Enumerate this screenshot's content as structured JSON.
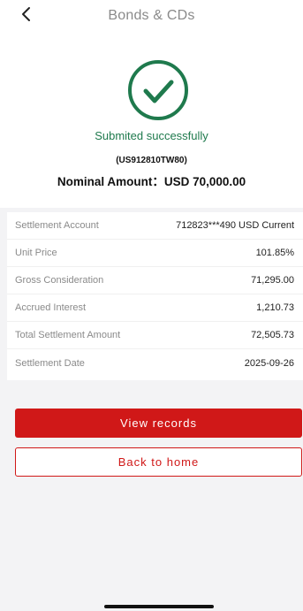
{
  "header": {
    "title": "Bonds & CDs",
    "back_icon": "chevron-left-icon"
  },
  "status": {
    "icon": "check-circle-icon",
    "message": "Submited successfully",
    "color": "#1f7a4d"
  },
  "bond": {
    "code": "(US912810TW80)",
    "nominal_label": "Nominal Amount：USD 70,000.00"
  },
  "details": [
    {
      "label": "Settlement Account",
      "value": "712823***490 USD Current"
    },
    {
      "label": "Unit Price",
      "value": "101.85%"
    },
    {
      "label": "Gross Consideration",
      "value": "71,295.00"
    },
    {
      "label": "Accrued Interest",
      "value": "1,210.73"
    },
    {
      "label": "Total Settlement Amount",
      "value": "72,505.73"
    },
    {
      "label": "Settlement Date",
      "value": "2025-09-26"
    }
  ],
  "actions": {
    "view_records": "View records",
    "back_home": "Back to home"
  },
  "colors": {
    "accent": "#d01818",
    "success": "#1f7a4d",
    "background": "#f3f3f5"
  }
}
